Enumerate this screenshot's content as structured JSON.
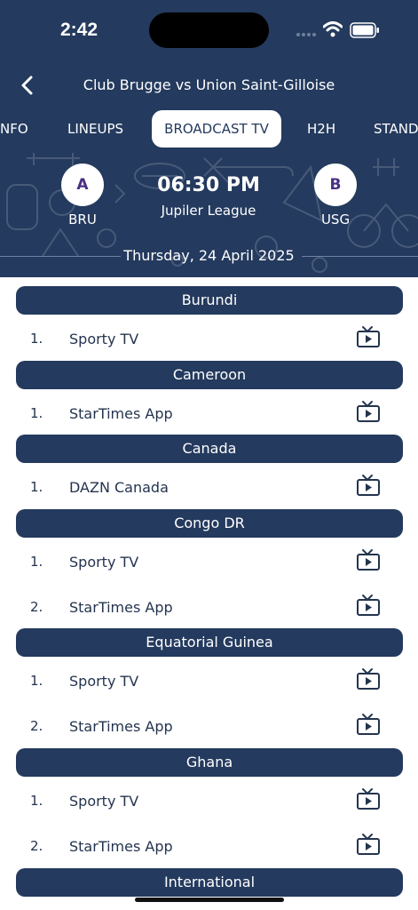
{
  "status_bar": {
    "time": "2:42"
  },
  "nav": {
    "title": "Club Brugge vs Union Saint-Gilloise"
  },
  "tabs": [
    {
      "label": "NFO",
      "active": false
    },
    {
      "label": "LINEUPS",
      "active": false
    },
    {
      "label": "BROADCAST TV",
      "active": true
    },
    {
      "label": "H2H",
      "active": false
    },
    {
      "label": "STAND",
      "active": false
    }
  ],
  "match": {
    "home": {
      "badge": "A",
      "code": "BRU"
    },
    "away": {
      "badge": "B",
      "code": "USG"
    },
    "kickoff": "06:30 PM",
    "league": "Jupiler League",
    "date": "Thursday, 24 April 2025"
  },
  "broadcasts": [
    {
      "country": "Burundi",
      "channels": [
        {
          "rank": "1.",
          "name": "Sporty TV"
        }
      ]
    },
    {
      "country": "Cameroon",
      "channels": [
        {
          "rank": "1.",
          "name": "StarTimes App"
        }
      ]
    },
    {
      "country": "Canada",
      "channels": [
        {
          "rank": "1.",
          "name": "DAZN Canada"
        }
      ]
    },
    {
      "country": "Congo DR",
      "channels": [
        {
          "rank": "1.",
          "name": "Sporty TV"
        },
        {
          "rank": "2.",
          "name": "StarTimes App"
        }
      ]
    },
    {
      "country": "Equatorial Guinea",
      "channels": [
        {
          "rank": "1.",
          "name": "Sporty TV"
        },
        {
          "rank": "2.",
          "name": "StarTimes App"
        }
      ]
    },
    {
      "country": "Ghana",
      "channels": [
        {
          "rank": "1.",
          "name": "Sporty TV"
        },
        {
          "rank": "2.",
          "name": "StarTimes App"
        }
      ]
    },
    {
      "country": "International",
      "channels": []
    }
  ],
  "colors": {
    "primary": "#243a5e",
    "text": "#24344f",
    "badge_text": "#4a2f86"
  },
  "icons": {
    "back": "chevron-left-icon",
    "tv": "tv-play-icon",
    "wifi": "wifi-icon",
    "battery": "battery-icon"
  }
}
